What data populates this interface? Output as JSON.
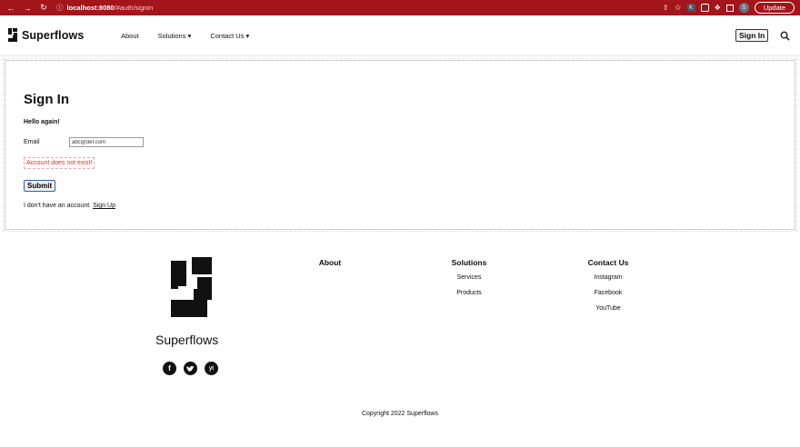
{
  "browser": {
    "url_host": "localhost:8080",
    "url_path": "/#auth/signin",
    "profile_initial": "S",
    "update_label": "Update"
  },
  "nav": {
    "brand": "Superflows",
    "links": [
      "About",
      "Solutions ▾",
      "Contact Us ▾"
    ],
    "signin_label": "Sign In"
  },
  "signin": {
    "title": "Sign In",
    "greeting": "Hello again!",
    "email_label": "Email",
    "email_value": "abc@def.com",
    "error": "Account does not exist!",
    "submit_label": "Submit",
    "no_account_text": "I don't have an account.",
    "signup_link": "Sign Up"
  },
  "footer": {
    "brand": "Superflows",
    "social": [
      "f",
      "t",
      "yt"
    ],
    "about": {
      "heading": "About"
    },
    "solutions": {
      "heading": "Solutions",
      "items": [
        "Services",
        "Products"
      ]
    },
    "contact": {
      "heading": "Contact Us",
      "items": [
        "Instagram",
        "Facebook",
        "YouTube"
      ]
    },
    "copyright": "Copyright 2022 Superflows"
  },
  "colors": {
    "browser_bar": "#a3141b",
    "error": "#dd3333",
    "submit_border": "#2b5fb8"
  }
}
